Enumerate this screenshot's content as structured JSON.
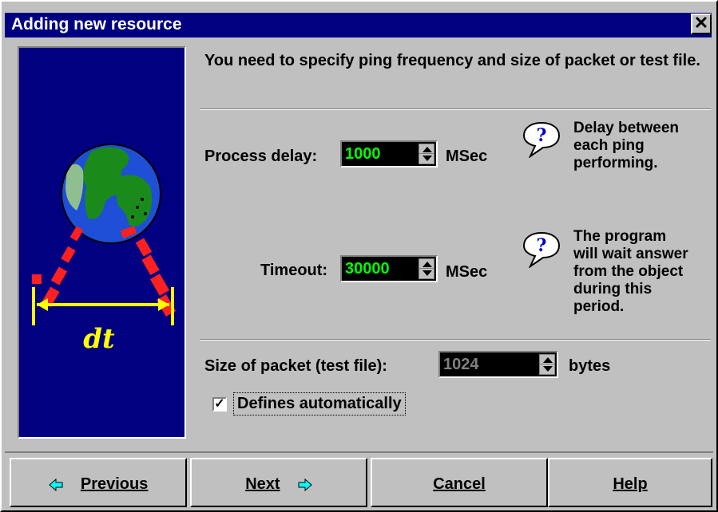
{
  "window": {
    "title": "Adding new resource",
    "close_glyph": "✕"
  },
  "illustration": {
    "label": "dt",
    "icon": "globe-ping-illustration"
  },
  "intro": {
    "text": "You need to specify ping frequency and size of packet or test file."
  },
  "process_delay": {
    "label": "Process delay:",
    "value": "1000",
    "unit": "MSec",
    "value_color": "#00ff00",
    "note": [
      "Delay between",
      "each ping",
      "performing."
    ]
  },
  "timeout": {
    "label": "Timeout:",
    "value": "30000",
    "unit": "MSec",
    "value_color": "#00ff00",
    "note": [
      "The program",
      "will wait answer",
      "from the object",
      "during this",
      "period."
    ]
  },
  "packet_size": {
    "label": "Size of packet (test file):",
    "value": "1024",
    "unit": "bytes",
    "value_color": "#808080",
    "disabled": true
  },
  "auto_checkbox": {
    "label": "Defines automatically",
    "checked": true,
    "mark": "✓"
  },
  "buttons": {
    "previous": {
      "label": "Previous",
      "hotkey": "P",
      "icon": "arrow-left-icon"
    },
    "next": {
      "label": "Next",
      "hotkey": "N",
      "icon": "arrow-right-icon"
    },
    "cancel": {
      "label": "Cancel",
      "hotkey": "C"
    },
    "help": {
      "label": "Help",
      "hotkey": "H"
    }
  },
  "colors": {
    "title_bar": "#000080",
    "face": "#c0c0c0",
    "arrow_cyan": "#00ffff"
  }
}
